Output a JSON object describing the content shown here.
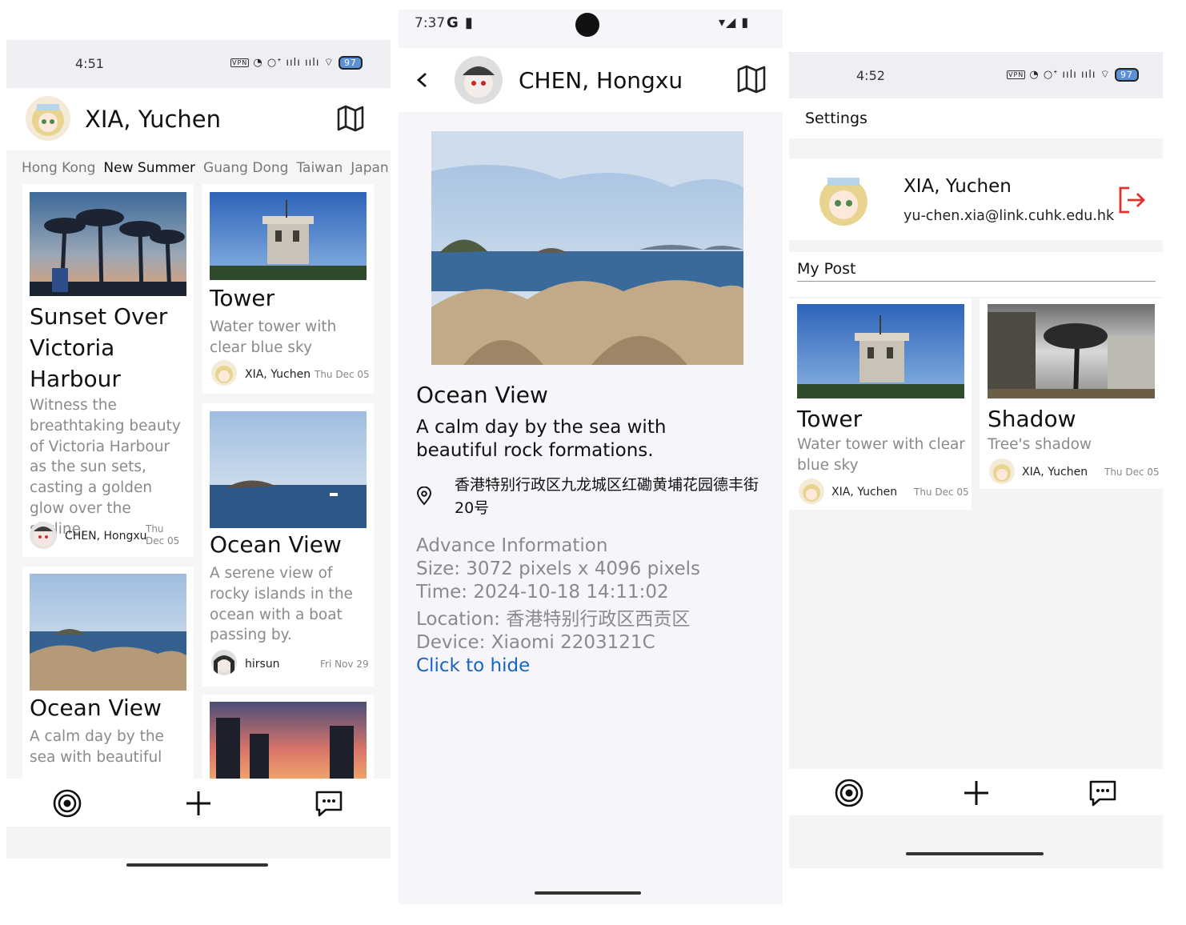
{
  "screen1": {
    "status": {
      "time": "4:51",
      "battery": "97"
    },
    "header": {
      "user_name": "XIA, Yuchen"
    },
    "tabs": [
      "Hong Kong",
      "New Summer",
      "Guang Dong",
      "Taiwan",
      "Japan"
    ],
    "active_tab": "New Summer",
    "cards": [
      {
        "title": "Sunset Over Victoria Harbour",
        "description": "Witness the breathtaking beauty of Victoria Harbour as the sun sets, casting a golden glow over the skyline.",
        "author": "CHEN, Hongxu",
        "date": "Thu Dec 05"
      },
      {
        "title": "Tower",
        "description": "Water tower with clear blue sky",
        "author": "XIA, Yuchen",
        "date": "Thu Dec 05"
      },
      {
        "title": "Ocean View",
        "description": "A serene view of rocky islands in the ocean with a boat passing by.",
        "author": "hirsun",
        "date": "Fri Nov 29"
      },
      {
        "title": "Ocean View",
        "description": "A calm day by the sea with beautiful"
      }
    ]
  },
  "screen2": {
    "status": {
      "time": "7:37"
    },
    "header": {
      "user_name": "CHEN, Hongxu"
    },
    "post": {
      "title": "Ocean View",
      "description": "A calm day by the sea with beautiful rock formations.",
      "address": "香港特别行政区九龙城区红磡黄埔花园德丰街20号"
    },
    "advance": {
      "heading": "Advance Information",
      "size": "Size: 3072 pixels x 4096 pixels",
      "time": "Time: 2024-10-18 14:11:02",
      "location": "Location: 香港特别行政区西贡区",
      "device": "Device: Xiaomi 2203121C",
      "toggle": "Click to hide"
    }
  },
  "screen3": {
    "status": {
      "time": "4:52",
      "battery": "97"
    },
    "header": {
      "title": "Settings"
    },
    "profile": {
      "name": "XIA, Yuchen",
      "email": "yu-chen.xia@link.cuhk.edu.hk"
    },
    "section_title": "My Post",
    "posts": [
      {
        "title": "Tower",
        "description": "Water tower with clear blue sky",
        "author": "XIA, Yuchen",
        "date": "Thu Dec 05"
      },
      {
        "title": "Shadow",
        "description": "Tree's shadow",
        "author": "XIA, Yuchen",
        "date": "Thu Dec 05"
      }
    ]
  },
  "colors": {
    "link": "#1a63c2",
    "logout": "#e0322a",
    "text_muted": "#8a8a8a",
    "background": "#f8f8f8"
  },
  "icons": [
    "map-icon",
    "back-icon",
    "location-pin-icon",
    "logout-icon",
    "target-icon",
    "plus-icon",
    "chat-icon"
  ]
}
